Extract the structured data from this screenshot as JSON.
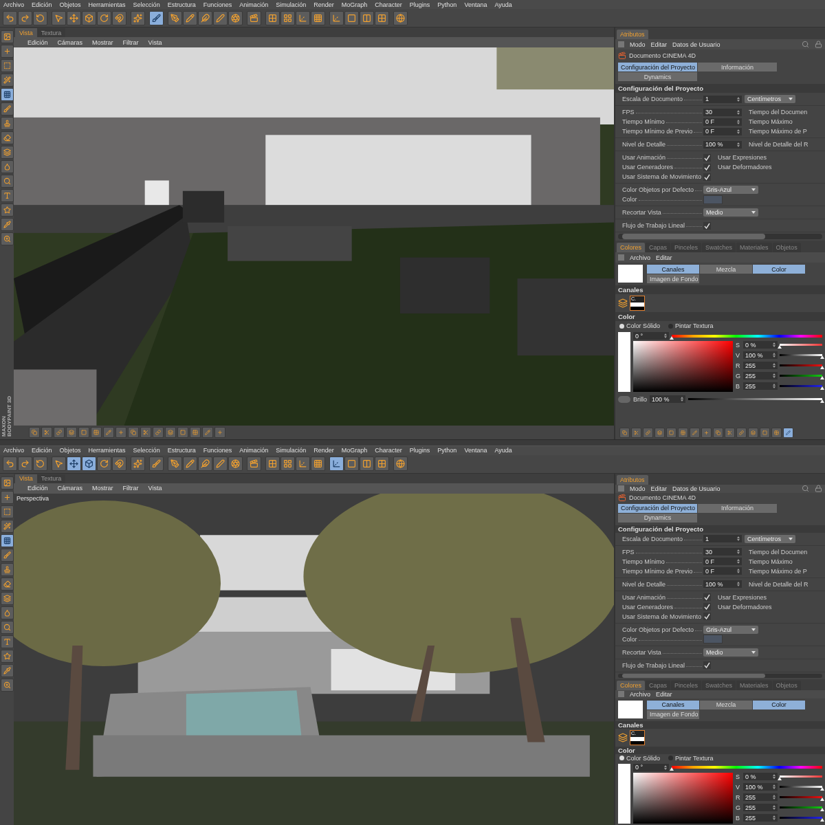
{
  "windows": [
    {
      "menu": [
        "Archivo",
        "Edición",
        "Objetos",
        "Herramientas",
        "Selección",
        "Estructura",
        "Funciones",
        "Animación",
        "Simulación",
        "Render",
        "MoGraph",
        "Character",
        "Plugins",
        "Python",
        "Ventana",
        "Ayuda"
      ],
      "toolbar": [
        [
          {
            "selected": false
          },
          {
            "selected": false
          },
          {
            "selected": false
          }
        ],
        [
          {
            "selected": false
          },
          {
            "selected": false
          },
          {
            "selected": false
          },
          {
            "selected": false
          },
          {
            "selected": false
          }
        ],
        [
          {
            "selected": false
          }
        ],
        [
          {
            "selected": true
          }
        ],
        [
          {
            "selected": false
          },
          {
            "selected": false
          },
          {
            "selected": false
          },
          {
            "selected": false
          },
          {
            "selected": false
          }
        ],
        [
          {
            "selected": false
          }
        ],
        [
          {
            "selected": false
          },
          {
            "selected": false
          },
          {
            "selected": false
          },
          {
            "selected": false
          }
        ],
        [
          {
            "selected": false
          },
          {
            "selected": false
          },
          {
            "selected": false
          },
          {
            "selected": false
          }
        ],
        [
          {
            "selected": false
          }
        ]
      ],
      "tools": [
        {
          "selected": false
        },
        {
          "selected": false
        },
        {
          "selected": false
        },
        {
          "selected": false
        },
        {
          "selected": true
        },
        {
          "selected": false
        },
        {
          "selected": false
        },
        {
          "selected": false
        },
        {
          "selected": false
        },
        {
          "selected": false
        },
        {
          "selected": false
        },
        {
          "selected": false
        },
        {
          "selected": false
        },
        {
          "selected": false
        },
        {
          "selected": false
        }
      ],
      "side_logo": [
        "MAXON",
        "BODYPAINT 3D"
      ],
      "view_tabs": [
        {
          "label": "Vista",
          "selected": true
        },
        {
          "label": "Textura",
          "selected": false
        }
      ],
      "view_menu": [
        "Edición",
        "Cámaras",
        "Mostrar",
        "Filtrar",
        "Vista"
      ],
      "view_strip": [
        {
          "selected": false
        },
        {
          "selected": false
        },
        {
          "selected": false
        },
        {
          "selected": false
        },
        {
          "selected": false
        },
        {
          "selected": false
        },
        {
          "selected": false
        },
        {
          "selected": false
        },
        {
          "selected": false
        },
        {
          "selected": false
        },
        {
          "selected": false
        },
        {
          "selected": false
        },
        {
          "selected": false
        },
        {
          "selected": false
        },
        {
          "selected": false
        },
        {
          "selected": false
        }
      ],
      "attributes": {
        "tab": "Atributos",
        "menu": [
          "Modo",
          "Editar",
          "Datos de Usuario"
        ],
        "document": "Documento CINEMA 4D",
        "tabs": [
          {
            "label": "Configuración del Proyecto",
            "selected": true
          },
          {
            "label": "Información",
            "selected": false
          },
          {
            "label": "Dynamics",
            "selected": false
          }
        ],
        "section": "Configuración del Proyecto",
        "groups": [
          [
            {
              "kind": "number",
              "label": "Escala de Documento",
              "value": "1",
              "unit": "Centímetros"
            }
          ],
          [
            {
              "kind": "number",
              "label": "FPS",
              "value": "30",
              "side": "Tiempo del Documen"
            },
            {
              "kind": "number",
              "label": "Tiempo Mínimo",
              "value": "0 F",
              "side": "Tiempo Máximo"
            },
            {
              "kind": "number",
              "label": "Tiempo Mínimo de Previo",
              "value": "0 F",
              "side": "Tiempo Máximo de P"
            }
          ],
          [
            {
              "kind": "number",
              "label": "Nivel de Detalle",
              "value": "100 %",
              "side": "Nivel de Detalle del R"
            }
          ],
          [
            {
              "kind": "check",
              "label": "Usar Animación",
              "checked": true,
              "side": "Usar Expresiones"
            },
            {
              "kind": "check",
              "label": "Usar Generadores",
              "checked": true,
              "side": "Usar Deformadores"
            },
            {
              "kind": "check",
              "label": "Usar Sistema de Movimiento",
              "checked": true
            }
          ],
          [
            {
              "kind": "dropdown",
              "label": "Color Objetos por Defecto",
              "value": "Gris-Azul"
            },
            {
              "kind": "color",
              "label": "Color",
              "color": "#4c5563"
            }
          ],
          [
            {
              "kind": "dropdown",
              "label": "Recortar Vista",
              "value": "Medio"
            }
          ],
          [
            {
              "kind": "check",
              "label": "Flujo de Trabajo Lineal",
              "checked": true
            }
          ]
        ]
      },
      "colors": {
        "tabs": [
          {
            "label": "Colores",
            "selected": true
          },
          {
            "label": "Capas",
            "selected": false
          },
          {
            "label": "Pinceles",
            "selected": false
          },
          {
            "label": "Swatches",
            "selected": false
          },
          {
            "label": "Materiales",
            "selected": false
          },
          {
            "label": "Objetos",
            "selected": false
          }
        ],
        "menu": [
          "Archivo",
          "Editar"
        ],
        "modes": [
          {
            "label": "Canales",
            "selected": true
          },
          {
            "label": "Mezcla",
            "selected": false
          },
          {
            "label": "Color",
            "selected": true
          },
          {
            "label": "Imagen de Fondo",
            "selected": false
          }
        ],
        "channels_header": "Canales",
        "channel_label": "C.",
        "color_header": "Color",
        "radios": [
          {
            "label": "Color Sólido",
            "selected": true
          },
          {
            "label": "Pintar Textura",
            "selected": false
          }
        ],
        "hue": {
          "value": "0 °",
          "level": 0
        },
        "sliders": [
          {
            "label": "S",
            "value": "0 %",
            "level": 0
          },
          {
            "label": "V",
            "value": "100 %",
            "level": 1
          },
          {
            "label": "R",
            "value": "255",
            "level": 1
          },
          {
            "label": "G",
            "value": "255",
            "level": 1
          },
          {
            "label": "B",
            "value": "255",
            "level": 1
          }
        ],
        "brightness": {
          "label": "Brillo",
          "value": "100 %",
          "level": 1
        },
        "footer": [
          {
            "selected": false
          },
          {
            "selected": false
          },
          {
            "selected": false
          },
          {
            "selected": false
          },
          {
            "selected": false
          },
          {
            "selected": false
          },
          {
            "selected": false
          },
          {
            "selected": false
          },
          {
            "selected": false
          },
          {
            "selected": false
          },
          {
            "selected": false
          },
          {
            "selected": false
          },
          {
            "selected": false
          },
          {
            "selected": false
          },
          {
            "selected": true
          }
        ]
      }
    },
    {
      "menu": [
        "Archivo",
        "Edición",
        "Objetos",
        "Herramientas",
        "Selección",
        "Estructura",
        "Funciones",
        "Animación",
        "Simulación",
        "Render",
        "MoGraph",
        "Character",
        "Plugins",
        "Python",
        "Ventana",
        "Ayuda"
      ],
      "toolbar": [
        [
          {
            "selected": false
          },
          {
            "selected": false
          },
          {
            "selected": false
          }
        ],
        [
          {
            "selected": false
          },
          {
            "selected": true
          },
          {
            "selected": true
          },
          {
            "selected": false
          },
          {
            "selected": false
          }
        ],
        [
          {
            "selected": false
          }
        ],
        [
          {
            "selected": false
          }
        ],
        [
          {
            "selected": false
          },
          {
            "selected": false
          },
          {
            "selected": false
          },
          {
            "selected": false
          },
          {
            "selected": false
          }
        ],
        [
          {
            "selected": false
          }
        ],
        [
          {
            "selected": false
          },
          {
            "selected": false
          },
          {
            "selected": false
          },
          {
            "selected": false
          }
        ],
        [
          {
            "selected": true
          },
          {
            "selected": false
          },
          {
            "selected": false
          },
          {
            "selected": false
          }
        ],
        [
          {
            "selected": false
          }
        ]
      ],
      "tools": [
        {
          "selected": false
        },
        {
          "selected": false
        },
        {
          "selected": false
        },
        {
          "selected": false
        },
        {
          "selected": true
        },
        {
          "selected": false
        },
        {
          "selected": false
        },
        {
          "selected": false
        },
        {
          "selected": false
        },
        {
          "selected": false
        },
        {
          "selected": false
        },
        {
          "selected": false
        },
        {
          "selected": false
        },
        {
          "selected": false
        },
        {
          "selected": false
        }
      ],
      "view_tabs": [
        {
          "label": "Vista",
          "selected": true
        },
        {
          "label": "Textura",
          "selected": false
        }
      ],
      "view_menu": [
        "Edición",
        "Cámaras",
        "Mostrar",
        "Filtrar",
        "Vista"
      ],
      "camera": "Perspectiva",
      "attributes": {
        "tab": "Atributos",
        "menu": [
          "Modo",
          "Editar",
          "Datos de Usuario"
        ],
        "document": "Documento CINEMA 4D",
        "tabs": [
          {
            "label": "Configuración del Proyecto",
            "selected": true
          },
          {
            "label": "Información",
            "selected": false
          },
          {
            "label": "Dynamics",
            "selected": false
          }
        ],
        "section": "Configuración del Proyecto",
        "groups": [
          [
            {
              "kind": "number",
              "label": "Escala de Documento",
              "value": "1",
              "unit": "Centímetros"
            }
          ],
          [
            {
              "kind": "number",
              "label": "FPS",
              "value": "30",
              "side": "Tiempo del Documen"
            },
            {
              "kind": "number",
              "label": "Tiempo Mínimo",
              "value": "0 F",
              "side": "Tiempo Máximo"
            },
            {
              "kind": "number",
              "label": "Tiempo Mínimo de Previo",
              "value": "0 F",
              "side": "Tiempo Máximo de P"
            }
          ],
          [
            {
              "kind": "number",
              "label": "Nivel de Detalle",
              "value": "100 %",
              "side": "Nivel de Detalle del R"
            }
          ],
          [
            {
              "kind": "check",
              "label": "Usar Animación",
              "checked": true,
              "side": "Usar Expresiones"
            },
            {
              "kind": "check",
              "label": "Usar Generadores",
              "checked": true,
              "side": "Usar Deformadores"
            },
            {
              "kind": "check",
              "label": "Usar Sistema de Movimiento",
              "checked": true
            }
          ],
          [
            {
              "kind": "dropdown",
              "label": "Color Objetos por Defecto",
              "value": "Gris-Azul"
            },
            {
              "kind": "color",
              "label": "Color",
              "color": "#4c5563"
            }
          ],
          [
            {
              "kind": "dropdown",
              "label": "Recortar Vista",
              "value": "Medio"
            }
          ],
          [
            {
              "kind": "check",
              "label": "Flujo de Trabajo Lineal",
              "checked": true
            }
          ]
        ]
      },
      "colors": {
        "tabs": [
          {
            "label": "Colores",
            "selected": true
          },
          {
            "label": "Capas",
            "selected": false
          },
          {
            "label": "Pinceles",
            "selected": false
          },
          {
            "label": "Swatches",
            "selected": false
          },
          {
            "label": "Materiales",
            "selected": false
          },
          {
            "label": "Objetos",
            "selected": false
          }
        ],
        "menu": [
          "Archivo",
          "Editar"
        ],
        "modes": [
          {
            "label": "Canales",
            "selected": true
          },
          {
            "label": "Mezcla",
            "selected": false
          },
          {
            "label": "Color",
            "selected": true
          },
          {
            "label": "Imagen de Fondo",
            "selected": false
          }
        ],
        "channels_header": "Canales",
        "channel_label": "C.",
        "color_header": "Color",
        "radios": [
          {
            "label": "Color Sólido",
            "selected": true
          },
          {
            "label": "Pintar Textura",
            "selected": false
          }
        ],
        "hue": {
          "value": "0 °",
          "level": 0
        },
        "sliders": [
          {
            "label": "S",
            "value": "0 %",
            "level": 0
          },
          {
            "label": "V",
            "value": "100 %",
            "level": 1
          },
          {
            "label": "R",
            "value": "255",
            "level": 1
          },
          {
            "label": "G",
            "value": "255",
            "level": 1
          },
          {
            "label": "B",
            "value": "255",
            "level": 1
          }
        ]
      }
    }
  ]
}
